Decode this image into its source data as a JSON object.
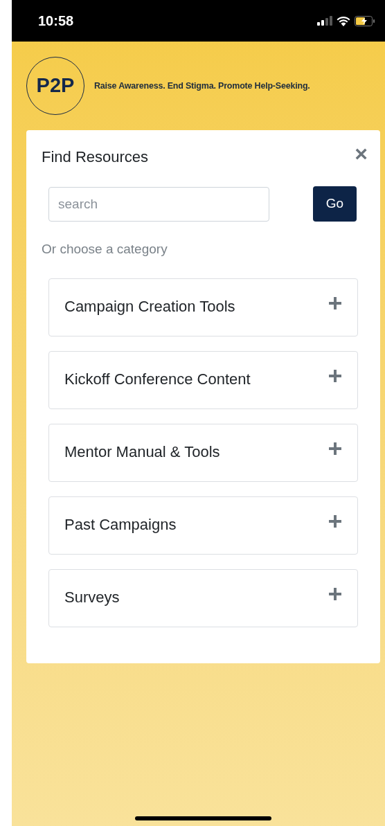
{
  "status_bar": {
    "time": "10:58"
  },
  "header": {
    "logo_text": "P2P",
    "tagline": "Raise Awareness. End Stigma. Promote Help-Seeking."
  },
  "panel": {
    "title": "Find Resources",
    "close": "×",
    "search": {
      "placeholder": "search"
    },
    "go_button": "Go",
    "category_prompt": "Or choose a category",
    "categories": [
      {
        "label": "Campaign Creation Tools",
        "expanded": false
      },
      {
        "label": "Kickoff Conference Content",
        "expanded": false
      },
      {
        "label": "Mentor Manual & Tools",
        "expanded": false
      },
      {
        "label": "Past Campaigns",
        "expanded": false
      },
      {
        "label": "Surveys",
        "expanded": false
      }
    ]
  }
}
